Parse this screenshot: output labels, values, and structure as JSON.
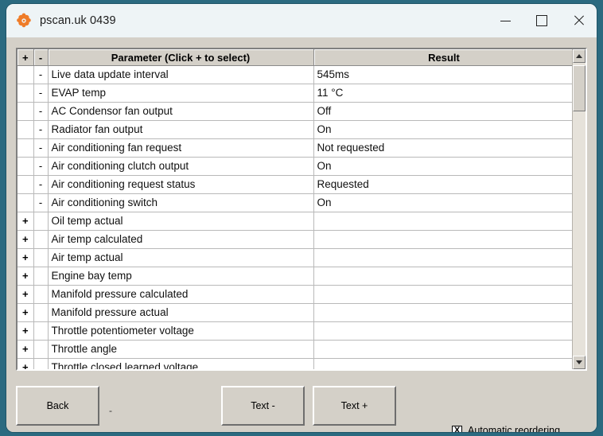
{
  "window": {
    "title": "pscan.uk 0439",
    "icon": "app-logo-icon",
    "controls": {
      "minimize": "minimize-icon",
      "maximize": "maximize-icon",
      "close": "close-icon"
    }
  },
  "grid": {
    "columns": [
      "+",
      "-",
      "Parameter (Click + to select)",
      "Result"
    ],
    "rows": [
      {
        "plus": "",
        "minus": "-",
        "parameter": "Live data update interval",
        "result": "545ms"
      },
      {
        "plus": "",
        "minus": "-",
        "parameter": "EVAP temp",
        "result": "11 °C"
      },
      {
        "plus": "",
        "minus": "-",
        "parameter": "AC Condensor fan output",
        "result": "Off"
      },
      {
        "plus": "",
        "minus": "-",
        "parameter": "Radiator fan output",
        "result": "On"
      },
      {
        "plus": "",
        "minus": "-",
        "parameter": "Air conditioning fan request",
        "result": "Not requested"
      },
      {
        "plus": "",
        "minus": "-",
        "parameter": "Air conditioning clutch output",
        "result": "On"
      },
      {
        "plus": "",
        "minus": "-",
        "parameter": "Air conditioning request status",
        "result": "Requested"
      },
      {
        "plus": "",
        "minus": "-",
        "parameter": "Air conditioning switch",
        "result": "On"
      },
      {
        "plus": "+",
        "minus": "",
        "parameter": "Oil temp actual",
        "result": ""
      },
      {
        "plus": "+",
        "minus": "",
        "parameter": "Air temp calculated",
        "result": ""
      },
      {
        "plus": "+",
        "minus": "",
        "parameter": "Air temp actual",
        "result": ""
      },
      {
        "plus": "+",
        "minus": "",
        "parameter": "Engine bay temp",
        "result": ""
      },
      {
        "plus": "+",
        "minus": "",
        "parameter": "Manifold pressure calculated",
        "result": ""
      },
      {
        "plus": "+",
        "minus": "",
        "parameter": "Manifold pressure actual",
        "result": ""
      },
      {
        "plus": "+",
        "minus": "",
        "parameter": "Throttle potentiometer voltage",
        "result": ""
      },
      {
        "plus": "+",
        "minus": "",
        "parameter": "Throttle angle",
        "result": ""
      },
      {
        "plus": "+",
        "minus": "",
        "parameter": "Throttle closed learned voltage",
        "result": ""
      }
    ]
  },
  "scrollbar": {
    "up_icon": "scroll-up-arrow-icon",
    "down_icon": "scroll-down-arrow-icon"
  },
  "footer": {
    "back_label": "Back",
    "dot_label": "-",
    "text_minus_label": "Text -",
    "text_plus_label": "Text +",
    "checkbox": {
      "label": "Automatic reordering",
      "mark": "X",
      "checked": true
    }
  },
  "colors": {
    "desktop": "#2b6a80",
    "dialog_face": "#d4d0c8",
    "titlebar": "#eef4f6",
    "grid_bg": "#ffffff",
    "logo_orange": "#ef7c28"
  }
}
